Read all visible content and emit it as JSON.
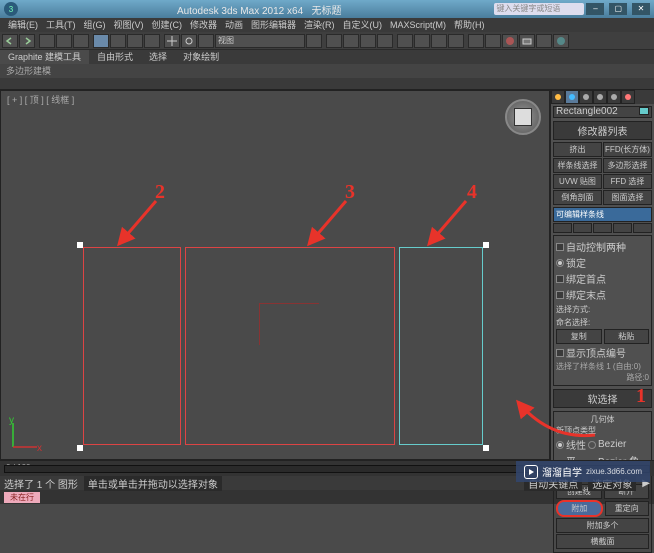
{
  "titlebar": {
    "app": "Autodesk 3ds Max 2012 x64",
    "doc": "无标题",
    "search_placeholder": "键入关键字或短语"
  },
  "menu": [
    "编辑(E)",
    "工具(T)",
    "组(G)",
    "视图(V)",
    "创建(C)",
    "修改器",
    "动画",
    "图形编辑器",
    "渲染(R)",
    "自定义(U)",
    "MAXScript(M)",
    "帮助(H)"
  ],
  "toolbar_dropdown": "视图",
  "ribbon": {
    "tabs": [
      "Graphite 建模工具",
      "自由形式",
      "选择",
      "对象绘制"
    ],
    "sub": "多边形建模"
  },
  "viewport": {
    "label": "[ + ] [ 顶 ] [ 线框 ]"
  },
  "panel": {
    "header": "修改器列表",
    "object_name": "Rectangle002",
    "btns_row1": [
      "挤出",
      "FFD(长方体)"
    ],
    "btns_row2": [
      "样条线选择",
      "多边形选择"
    ],
    "btns_row3": [
      "UVW 贴图",
      "FFD 选择"
    ],
    "btns_row4": [
      "倒角剖面",
      "图面选择"
    ],
    "stack_item": "可编辑样条线",
    "section_interp": {
      "row1": "自动控制两种",
      "row_lock": "锁定",
      "row_bind1": "绑定首点",
      "row_bind2": "绑定末点",
      "title_sel": "选择方式:",
      "title_area": "命名选择:",
      "btn_copy": "复制",
      "btn_paste": "粘贴",
      "title_vert": "显示顶点编号",
      "sel_info": "选择了样条线 1 (自由:0)",
      "seg_label": "路径:0"
    },
    "section_soft": "软选择",
    "section_geo": {
      "title": "几何体",
      "new_title": "新顶点类型",
      "r1a": "线性",
      "r1b": "Bezier",
      "r2a": "平滑",
      "r2b": "Bezier 角点",
      "btn_create": "创建线",
      "btn_break": "断开",
      "btn_attach": "附加",
      "btn_attach2": "重定向",
      "btn_attachm": "附加多个",
      "btn_cross": "横截面"
    }
  },
  "annotations": {
    "a1": "1",
    "a2": "2",
    "a3": "3",
    "a4": "4"
  },
  "status": {
    "sel": "选择了 1 个 图形",
    "hint": "单击或单击并拖动以选择对象",
    "auto": "自动关键点",
    "setkey": "选定对象"
  },
  "bottom_tag": "未在行",
  "timeline_range": "0 / 100",
  "watermark": {
    "text": "溜溜自学",
    "url": "zixue.3d66.com"
  }
}
